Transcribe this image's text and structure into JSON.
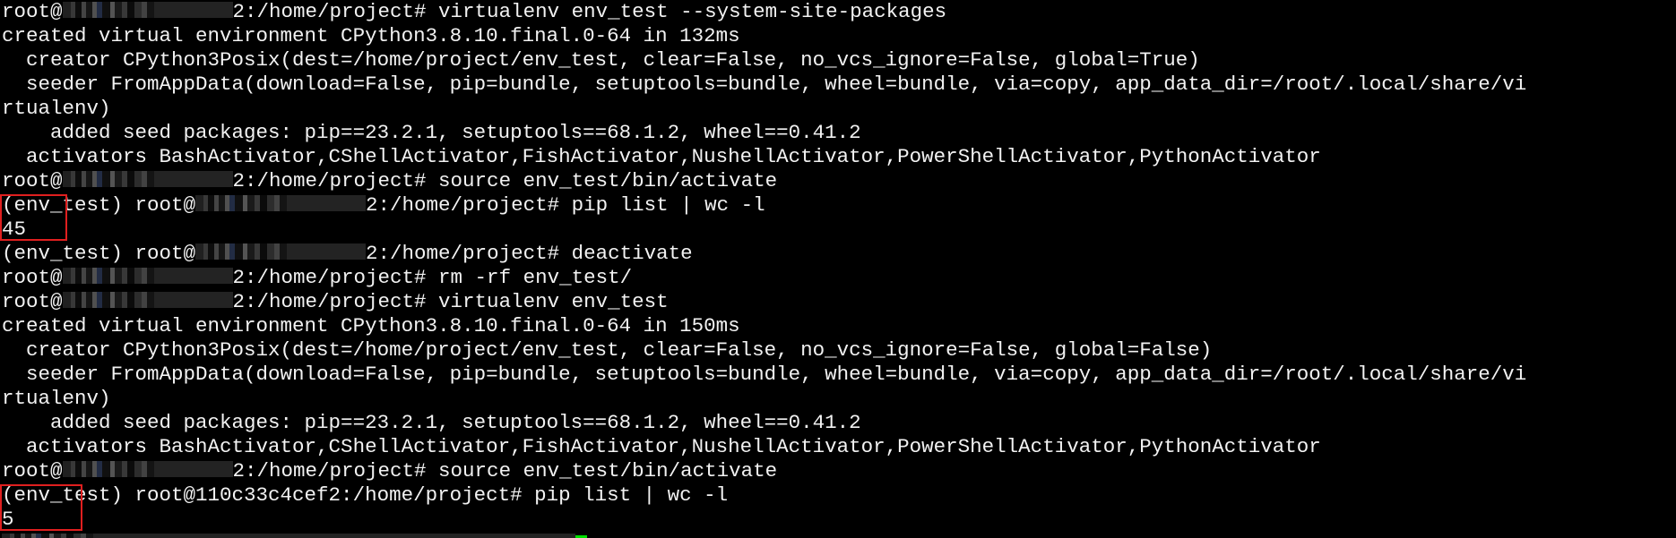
{
  "terminal": {
    "prompt_user": "root@",
    "cursor_color": "#00e000",
    "highlight_color": "#e01f1f",
    "lines": [
      {
        "kind": "prompt",
        "prefix": "root@",
        "redact": 190,
        "rest": "2:/home/project# virtualenv env_test --system-site-packages"
      },
      {
        "kind": "output",
        "text": "created virtual environment CPython3.8.10.final.0-64 in 132ms"
      },
      {
        "kind": "output",
        "text": "  creator CPython3Posix(dest=/home/project/env_test, clear=False, no_vcs_ignore=False, global=True)"
      },
      {
        "kind": "output",
        "text": "  seeder FromAppData(download=False, pip=bundle, setuptools=bundle, wheel=bundle, via=copy, app_data_dir=/root/.local/share/vi"
      },
      {
        "kind": "output",
        "text": "rtualenv)"
      },
      {
        "kind": "output",
        "text": "    added seed packages: pip==23.2.1, setuptools==68.1.2, wheel==0.41.2"
      },
      {
        "kind": "output",
        "text": "  activators BashActivator,CShellActivator,FishActivator,NushellActivator,PowerShellActivator,PythonActivator"
      },
      {
        "kind": "prompt",
        "prefix": "root@",
        "redact": 190,
        "rest": "2:/home/project# source env_test/bin/activate"
      },
      {
        "kind": "prompt",
        "prefix": "(env_test) root@",
        "redact": 190,
        "rest": "2:/home/project# pip list | wc -l"
      },
      {
        "kind": "output",
        "text": "45"
      },
      {
        "kind": "prompt",
        "prefix": "(env_test) root@",
        "redact": 190,
        "rest": "2:/home/project# deactivate"
      },
      {
        "kind": "prompt",
        "prefix": "root@",
        "redact": 190,
        "rest": "2:/home/project# rm -rf env_test/"
      },
      {
        "kind": "prompt",
        "prefix": "root@",
        "redact": 190,
        "rest": "2:/home/project# virtualenv env_test"
      },
      {
        "kind": "output",
        "text": "created virtual environment CPython3.8.10.final.0-64 in 150ms"
      },
      {
        "kind": "output",
        "text": "  creator CPython3Posix(dest=/home/project/env_test, clear=False, no_vcs_ignore=False, global=False)"
      },
      {
        "kind": "output",
        "text": "  seeder FromAppData(download=False, pip=bundle, setuptools=bundle, wheel=bundle, via=copy, app_data_dir=/root/.local/share/vi"
      },
      {
        "kind": "output",
        "text": "rtualenv)"
      },
      {
        "kind": "output",
        "text": "    added seed packages: pip==23.2.1, setuptools==68.1.2, wheel==0.41.2"
      },
      {
        "kind": "output",
        "text": "  activators BashActivator,CShellActivator,FishActivator,NushellActivator,PowerShellActivator,PythonActivator"
      },
      {
        "kind": "prompt",
        "prefix": "root@",
        "redact": 190,
        "rest": "2:/home/project# source env_test/bin/activate"
      },
      {
        "kind": "prompt",
        "prefix": "(env_test) root@110c33c4cef2:/home/project# pip list | wc -l",
        "redact": 0,
        "rest": ""
      },
      {
        "kind": "output",
        "text": "5"
      },
      {
        "kind": "prompt_cursor",
        "prefix": "",
        "redact": 640,
        "rest": ""
      }
    ]
  }
}
